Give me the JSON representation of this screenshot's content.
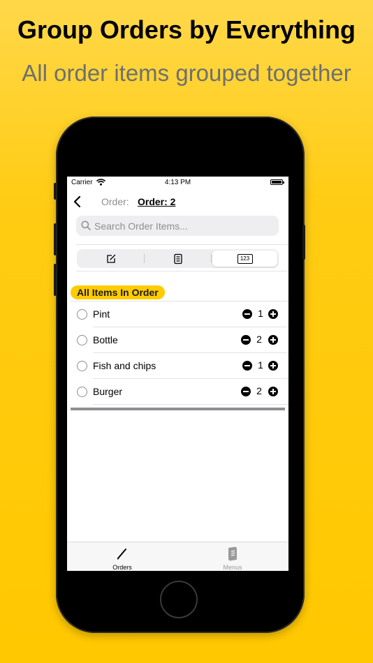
{
  "promo": {
    "headline": "Group Orders by Everything",
    "subline": "All order items grouped together"
  },
  "status_bar": {
    "carrier": "Carrier",
    "time": "4:13 PM"
  },
  "nav": {
    "order_label": "Order:",
    "order_value": "Order: 2"
  },
  "search": {
    "placeholder": "Search Order Items..."
  },
  "segments": [
    {
      "icon": "compose-icon",
      "selected": false
    },
    {
      "icon": "menu-book-icon",
      "selected": false
    },
    {
      "icon": "numbers-123-icon",
      "selected": true,
      "label": "123"
    }
  ],
  "section": {
    "title": "All Items In Order"
  },
  "items": [
    {
      "name": "Pint",
      "qty": "1"
    },
    {
      "name": "Bottle",
      "qty": "2"
    },
    {
      "name": "Fish and chips",
      "qty": "1"
    },
    {
      "name": "Burger",
      "qty": "2"
    }
  ],
  "tabs": [
    {
      "label": "Orders",
      "icon": "pencil-icon",
      "active": true
    },
    {
      "label": "Menus",
      "icon": "menu-book-icon",
      "active": false
    }
  ],
  "colors": {
    "accent": "#ffcc00",
    "background": "#ffc800",
    "subtitle": "#6f6f6f",
    "inactive_tab": "#9a9a9a"
  }
}
